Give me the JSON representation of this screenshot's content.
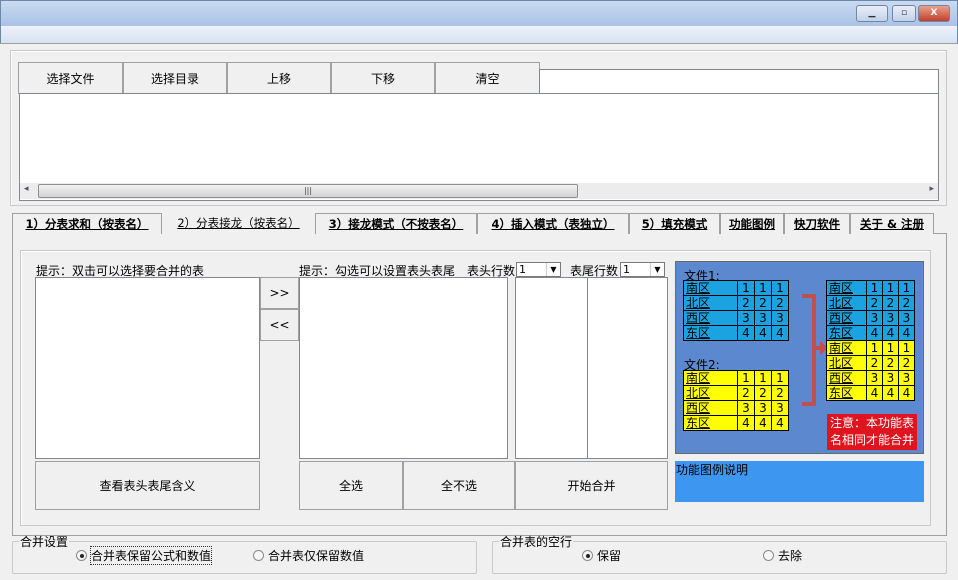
{
  "window": {
    "minimize_icon": "minimize-icon",
    "maximize_icon": "maximize-icon",
    "close_icon": "close-icon",
    "close_label": "X"
  },
  "toolbar": {
    "select_file": "选择文件",
    "select_dir": "选择目录",
    "move_up": "上移",
    "move_down": "下移",
    "clear": "清空"
  },
  "scrollbar": {
    "grip": "|||",
    "left": "◂",
    "right": "▸"
  },
  "tabs": [
    {
      "label": "1）分表求和（按表名）"
    },
    {
      "label": "2）分表接龙（按表名）",
      "selected": true
    },
    {
      "label": "3）接龙模式（不按表名）"
    },
    {
      "label": "4）插入模式（表独立）"
    },
    {
      "label": "5）填充模式"
    },
    {
      "label": "功能图例"
    },
    {
      "label": "快刀软件"
    },
    {
      "label": "关于 & 注册"
    }
  ],
  "panel": {
    "hint_left": "提示：双击可以选择要合并的表",
    "hint_mid": "提示：勾选可以设置表头表尾",
    "header_rows_label": "表头行数",
    "header_rows_value": "1",
    "footer_rows_label": "表尾行数",
    "footer_rows_value": "1",
    "add_button": ">>",
    "remove_button": "<<",
    "view_meaning_button": "查看表头表尾含义",
    "select_all_button": "全选",
    "select_none_button": "全不选",
    "start_merge_button": "开始合并",
    "description": "功能图例说明"
  },
  "illustration": {
    "file1_label": "文件1:",
    "file2_label": "文件2:",
    "rows": [
      [
        "南区",
        "1",
        "1",
        "1"
      ],
      [
        "北区",
        "2",
        "2",
        "2"
      ],
      [
        "西区",
        "3",
        "3",
        "3"
      ],
      [
        "东区",
        "4",
        "4",
        "4"
      ]
    ],
    "note_line1": "注意：本功能表",
    "note_line2": "名相同才能合并",
    "colors": {
      "panel": "#5b88cf",
      "file1": "#1aa3e0",
      "file2": "#ffff00",
      "note": "#e0141e",
      "arrow": "#c0504d"
    }
  },
  "merge_settings": {
    "title": "合并设置",
    "option1": "合并表保留公式和数值",
    "option2": "合并表仅保留数值",
    "selected": 1
  },
  "empty_rows": {
    "title": "合并表的空行",
    "option1": "保留",
    "option2": "去除",
    "selected": 1
  }
}
